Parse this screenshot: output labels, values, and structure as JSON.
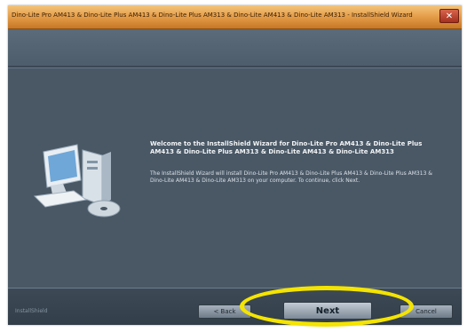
{
  "window": {
    "title": "Dino-Lite Pro AM413 & Dino-Lite Plus AM413 & Dino-Lite Plus AM313 & Dino-Lite AM413 & Dino-Lite AM313 - InstallShield Wizard",
    "close_glyph": "✕"
  },
  "welcome": {
    "title": "Welcome to the InstallShield Wizard for Dino-Lite Pro AM413 & Dino-Lite Plus AM413 & Dino-Lite Plus AM313 & Dino-Lite AM413 & Dino-Lite AM313",
    "body": "The InstallShield Wizard will install Dino-Lite Pro AM413 & Dino-Lite Plus AM413 & Dino-Lite Plus AM313 & Dino-Lite AM413 & Dino-Lite AM313 on your computer. To continue, click Next."
  },
  "footer": {
    "brand": "InstallShield",
    "back_label": "< Back",
    "next_label": "Next",
    "cancel_label": "Cancel"
  },
  "colors": {
    "highlight": "#f4e400",
    "dialog_bg": "#4a5866",
    "titlebar": "#e6a04c"
  }
}
